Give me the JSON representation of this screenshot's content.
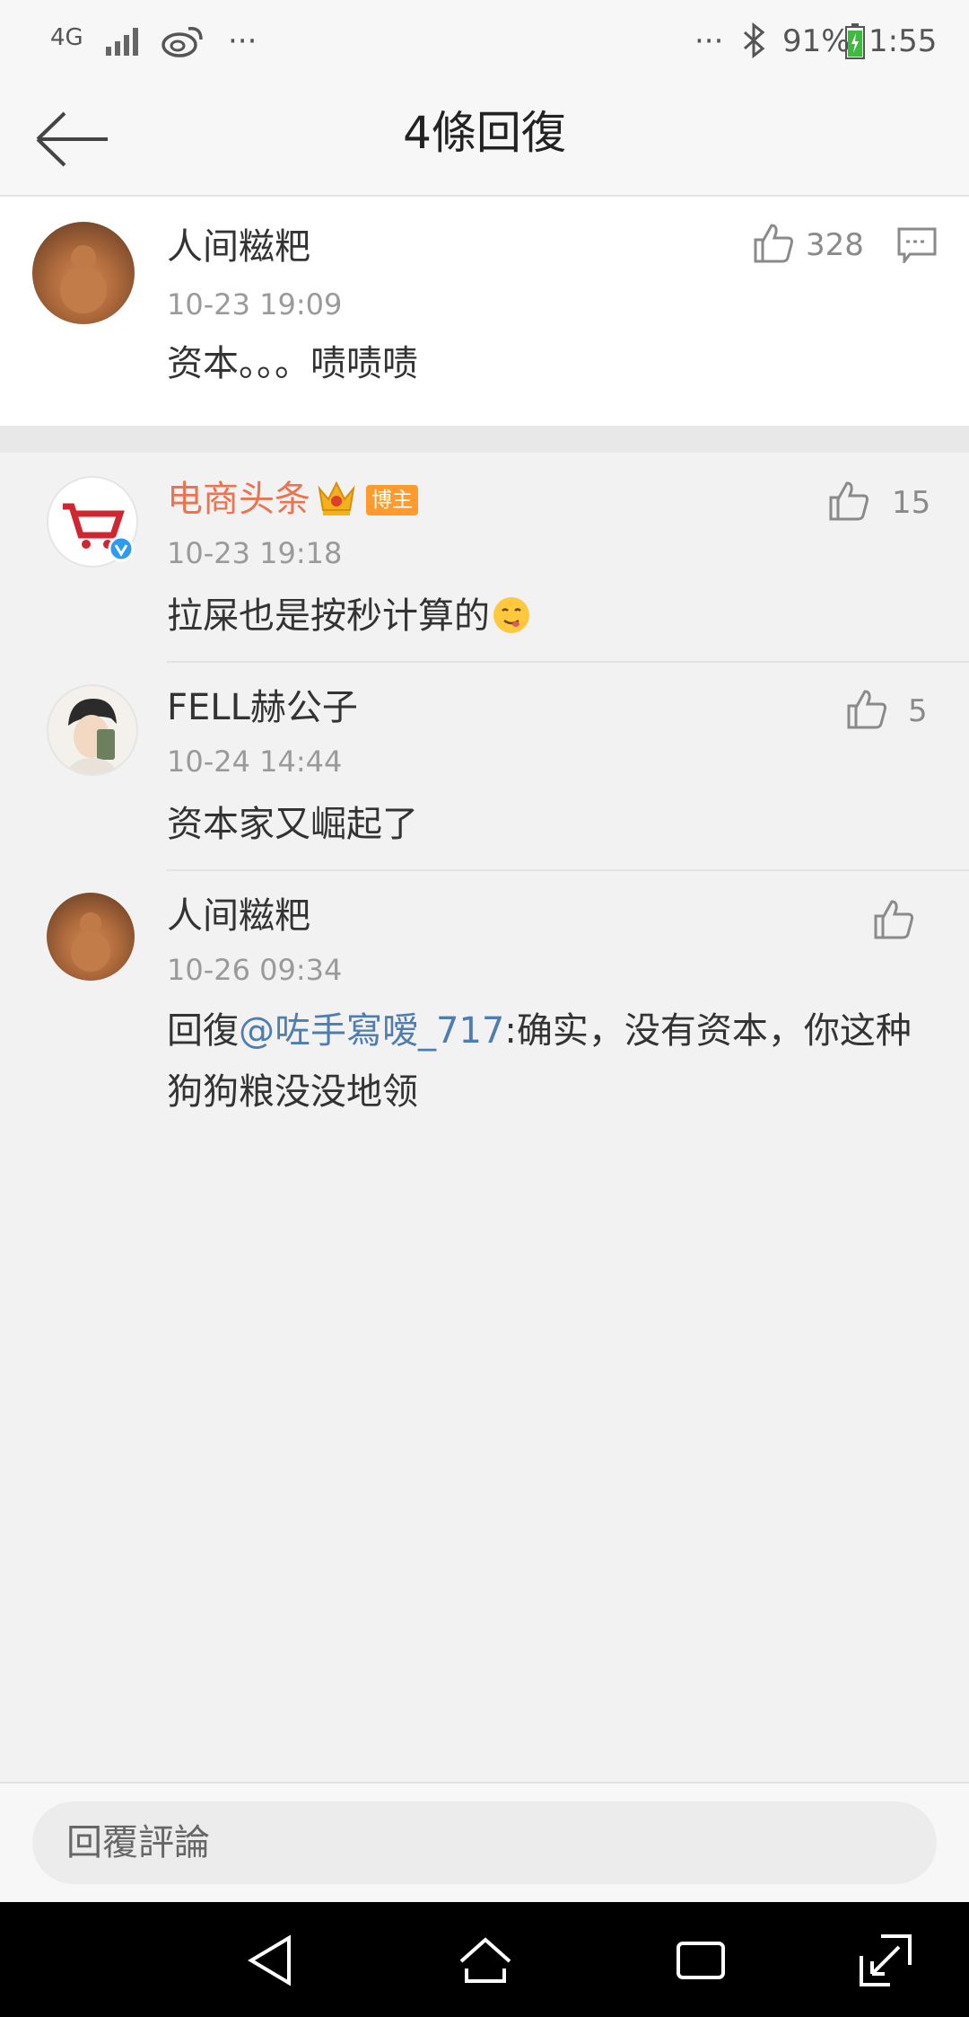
{
  "status_bar": {
    "network": "4G",
    "left_dots": "···",
    "right_dots": "···",
    "battery": "91%",
    "time": "1:55"
  },
  "header": {
    "title": "4條回復"
  },
  "original_comment": {
    "user": "人间糍粑",
    "time": "10-23 19:09",
    "text": "资本。。。啧啧啧",
    "likes": "328"
  },
  "replies": [
    {
      "user": "电商头条",
      "badge": "博主",
      "time": "10-23 19:18",
      "text": "拉屎也是按秒计算的",
      "likes": "15"
    },
    {
      "user": "FELL赫公子",
      "time": "10-24 14:44",
      "text": "资本家又崛起了",
      "likes": "5"
    },
    {
      "user": "人间糍粑",
      "time": "10-26 09:34",
      "text_prefix": "回復",
      "mention": "@咗手寫嗳_717",
      "text_suffix": ":确实，没有资本，你这种狗狗粮没没地领",
      "likes": ""
    }
  ],
  "reply_bar": {
    "placeholder": "回覆評論"
  },
  "colors": {
    "brand_orange": "#eb7350",
    "mention_blue": "#507daf",
    "verified_blue": "#2d9bf0"
  }
}
